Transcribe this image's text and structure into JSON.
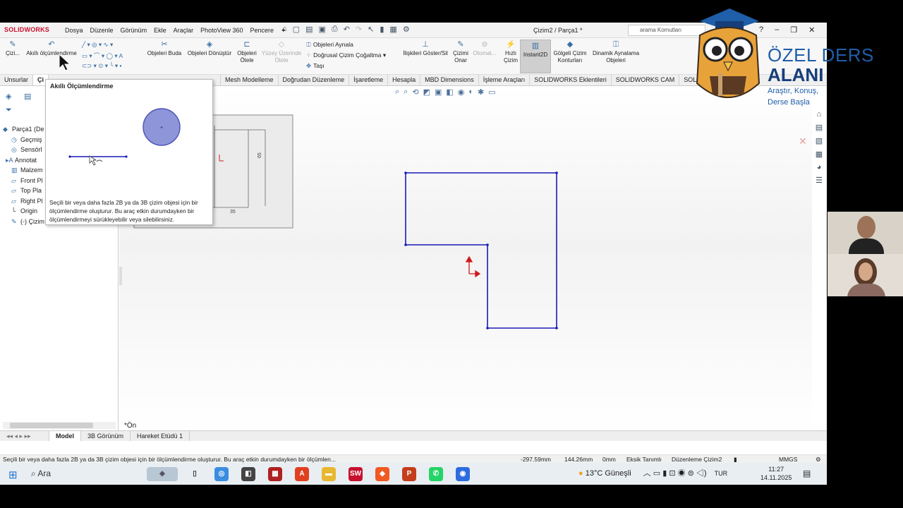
{
  "app": {
    "logo": "SOLIDWORKS",
    "menu": [
      "Dosya",
      "Düzenle",
      "Görünüm",
      "Ekle",
      "Araçlar",
      "PhotoView 360",
      "Pencere"
    ],
    "doc_title": "Çizim2 / Parça1 *",
    "search_placeholder": "arama Komutları"
  },
  "commands": {
    "sketch": "Çizi...",
    "smart_dim": "Akıllı ölçümlendirme",
    "trim": "Objeleri Buda",
    "convert": "Objeleri Dönüştür",
    "offset": "Objeleri Ötele",
    "surface_offset": "Yüzey Üzerinde Ötele",
    "mirror": "Objeleri Aynala",
    "linear_pattern": "Doğrusal Çizim Çoğaltma",
    "move": "Taşı",
    "relations": "İlişkileri Göster/Sil",
    "repair": "Çizimi Onar",
    "auto": "Otomat...",
    "rapid": "Hızlı Çizim",
    "instant2d": "Instant2D",
    "shaded": "Gölgeli Çizim Konturları",
    "dynamic_mirror": "Dinamik Aynalama Objeleri"
  },
  "tabs": [
    "Unsurlar",
    "Çi",
    "",
    "Mesh Modelleme",
    "Doğrudan Düzenleme",
    "İşaretleme",
    "Hesapla",
    "MBD Dimensions",
    "İşleme Araçları",
    "SOLIDWORKS Eklentileri",
    "SOLIDWORKS CAM",
    "SOLIDW"
  ],
  "tree": [
    "Parça1 (De",
    "Geçmiş",
    "Sensörl",
    "Annotat",
    "Malzem",
    "Front Pl",
    "Top Pla",
    "Right Pl",
    "Origin",
    "(-) Çizim"
  ],
  "tooltip": {
    "title": "Akıllı Ölçümlendirme",
    "text": "Seçili bir veya daha fazla 2B ya da 3B çizim objesi için bir ölçümlendirme oluşturur. Bu araç etkin durumdayken bir ölçümlendirmeyi sürükleyebilir veya silebilirsiniz."
  },
  "preview": {
    "dim_h": "35",
    "dim_v": "65"
  },
  "view_label": "*Ön",
  "bottom_tabs": [
    "Model",
    "3B Görünüm",
    "Hareket Etüdü 1"
  ],
  "status": {
    "message": "Seçili bir veya daha fazla 2B ya da 3B çizim objesi için bir ölçümlendirme oluşturur. Bu araç etkin durumdayken bir ölçümlen...",
    "x": "-297.59mm",
    "y": "144.26mm",
    "z": "0mm",
    "defined": "Eksik Tanımlı",
    "editing": "Düzenleme Çizim2",
    "units": "MMGS"
  },
  "taskbar": {
    "search": "Ara",
    "weather": "13°C Güneşli",
    "lang": "TUR",
    "time": "11:27",
    "date": "14.11.2025"
  },
  "brand": {
    "line1": "ÖZEL DERS",
    "line2": "ALANI",
    "line3": "Araştır, Konuş,",
    "line4": "Derse Başla"
  },
  "colors": {
    "sketch_line": "#1a1ab8",
    "origin": "#d01818",
    "brand": "#1f5ea8"
  }
}
